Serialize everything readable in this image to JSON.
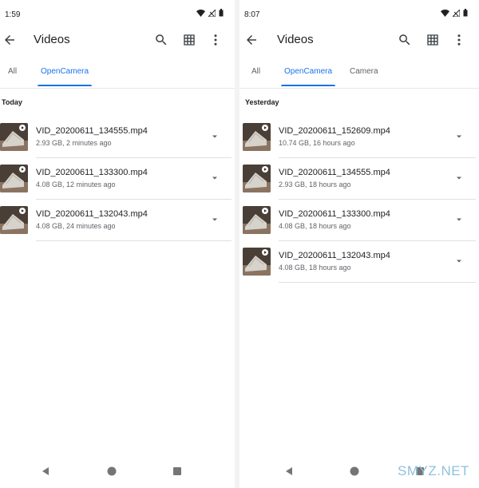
{
  "left": {
    "status_time": "1:59",
    "title": "Videos",
    "tabs": [
      {
        "label": "All",
        "active": false
      },
      {
        "label": "OpenCamera",
        "active": true
      }
    ],
    "section": "Today",
    "items": [
      {
        "name": "VID_20200611_134555.mp4",
        "meta": "2.93 GB, 2 minutes ago"
      },
      {
        "name": "VID_20200611_133300.mp4",
        "meta": "4.08 GB, 12 minutes ago"
      },
      {
        "name": "VID_20200611_132043.mp4",
        "meta": "4.08 GB, 24 minutes ago"
      }
    ]
  },
  "right": {
    "status_time": "8:07",
    "title": "Videos",
    "tabs": [
      {
        "label": "All",
        "active": false
      },
      {
        "label": "OpenCamera",
        "active": true
      },
      {
        "label": "Camera",
        "active": false
      }
    ],
    "section": "Yesterday",
    "items": [
      {
        "name": "VID_20200611_152609.mp4",
        "meta": "10.74 GB, 16 hours ago"
      },
      {
        "name": "VID_20200611_134555.mp4",
        "meta": "2.93 GB, 18 hours ago"
      },
      {
        "name": "VID_20200611_133300.mp4",
        "meta": "4.08 GB, 18 hours ago"
      },
      {
        "name": "VID_20200611_132043.mp4",
        "meta": "4.08 GB, 18 hours ago"
      }
    ]
  },
  "icons": {
    "back": "arrow-back-icon",
    "search": "search-icon",
    "grid": "grid-view-icon",
    "more": "more-vert-icon",
    "row_menu": "dropdown-arrow-icon",
    "nav": [
      "nav-back-icon",
      "nav-home-icon",
      "nav-recents-icon"
    ]
  },
  "colors": {
    "accent": "#1a73e8",
    "text_primary": "#202124",
    "text_secondary": "#5f6368",
    "divider": "#e0e0e0"
  },
  "watermark": "SMYZ.NET"
}
